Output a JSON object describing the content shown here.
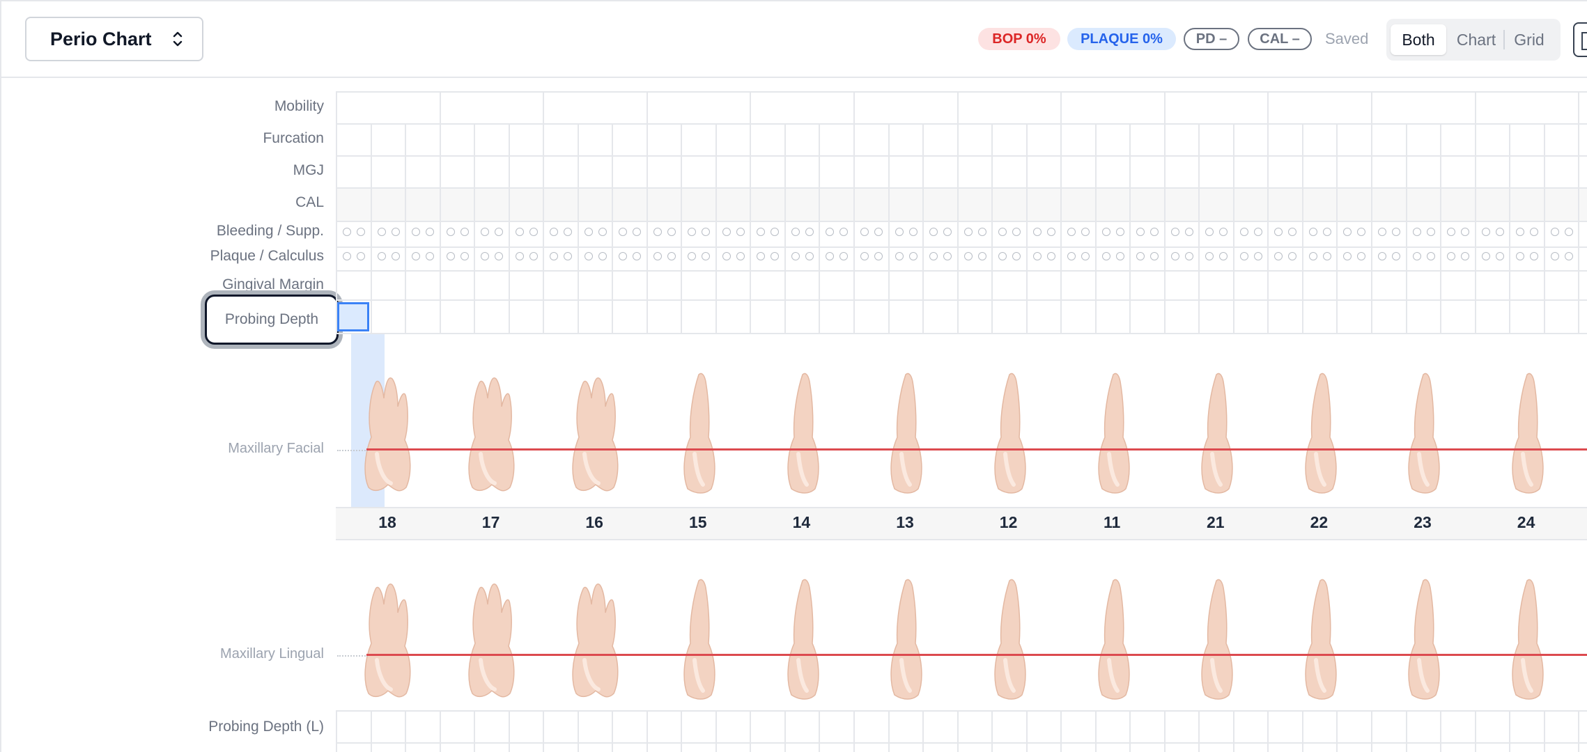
{
  "header": {
    "chart_selector": "Perio Chart",
    "badges": {
      "bop": "BOP 0%",
      "plaque": "PLAQUE 0%",
      "pd": "PD –",
      "cal": "CAL –"
    },
    "status": "Saved",
    "view_options": [
      "Both",
      "Chart",
      "Grid"
    ],
    "active_view": "Both"
  },
  "rows": {
    "mobility": "Mobility",
    "furcation": "Furcation",
    "mgj": "MGJ",
    "cal": "CAL",
    "bleeding": "Bleeding / Supp.",
    "plaque": "Plaque / Calculus",
    "gingival_margin": "Gingival Margin",
    "probing_depth": "Probing Depth",
    "probing_depth_l": "Probing Depth (L)"
  },
  "arch_labels": {
    "facial": "Maxillary Facial",
    "lingual": "Maxillary Lingual"
  },
  "teeth": [
    "18",
    "17",
    "16",
    "15",
    "14",
    "13",
    "12",
    "11",
    "21",
    "22",
    "23",
    "24"
  ],
  "colors": {
    "bop": "#dc2626",
    "plaque": "#2563eb",
    "gum_line": "#dc4a4f",
    "focus": "#0f172a",
    "tooth": "#f2cdb8"
  }
}
